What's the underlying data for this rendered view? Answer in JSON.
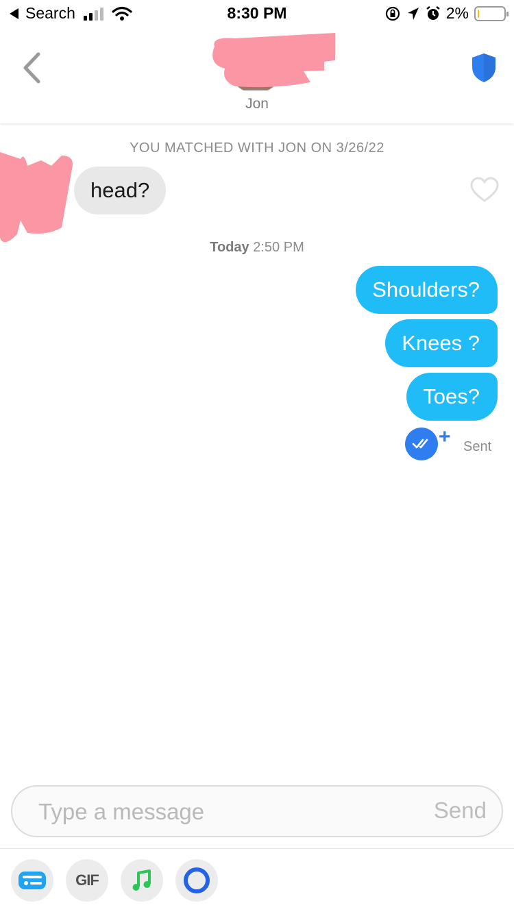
{
  "status_bar": {
    "back_label": "Search",
    "time": "8:30 PM",
    "battery_percent": "2%",
    "battery_level": 0.02,
    "battery_color": "#f2c200",
    "icons": [
      "back-arrow-icon",
      "cellular-signal-icon",
      "wifi-icon",
      "orientation-lock-icon",
      "location-arrow-icon",
      "alarm-icon",
      "battery-icon"
    ]
  },
  "header": {
    "name": "Jon",
    "back_icon": "chevron-left-icon",
    "safety_icon": "shield-icon",
    "accent_color": "#2f7ef0"
  },
  "chat": {
    "match_notice": "YOU MATCHED WITH JON ON 3/26/22",
    "incoming": [
      {
        "text": "head?",
        "liked": false
      }
    ],
    "timestamp_day": "Today",
    "timestamp_time": "2:50 PM",
    "outgoing": [
      {
        "text": "Shoulders?"
      },
      {
        "text": "Knees ?"
      },
      {
        "text": "Toes?"
      }
    ],
    "outgoing_color": "#1fbcf7",
    "incoming_color": "#e8e8e8",
    "status": "Sent"
  },
  "composer": {
    "placeholder": "Type a message",
    "send_label": "Send"
  },
  "toolbar": {
    "gif_label": "GIF",
    "buttons": [
      "sticker-card-icon",
      "gif-button",
      "music-note-icon",
      "loop-ring-icon"
    ]
  }
}
